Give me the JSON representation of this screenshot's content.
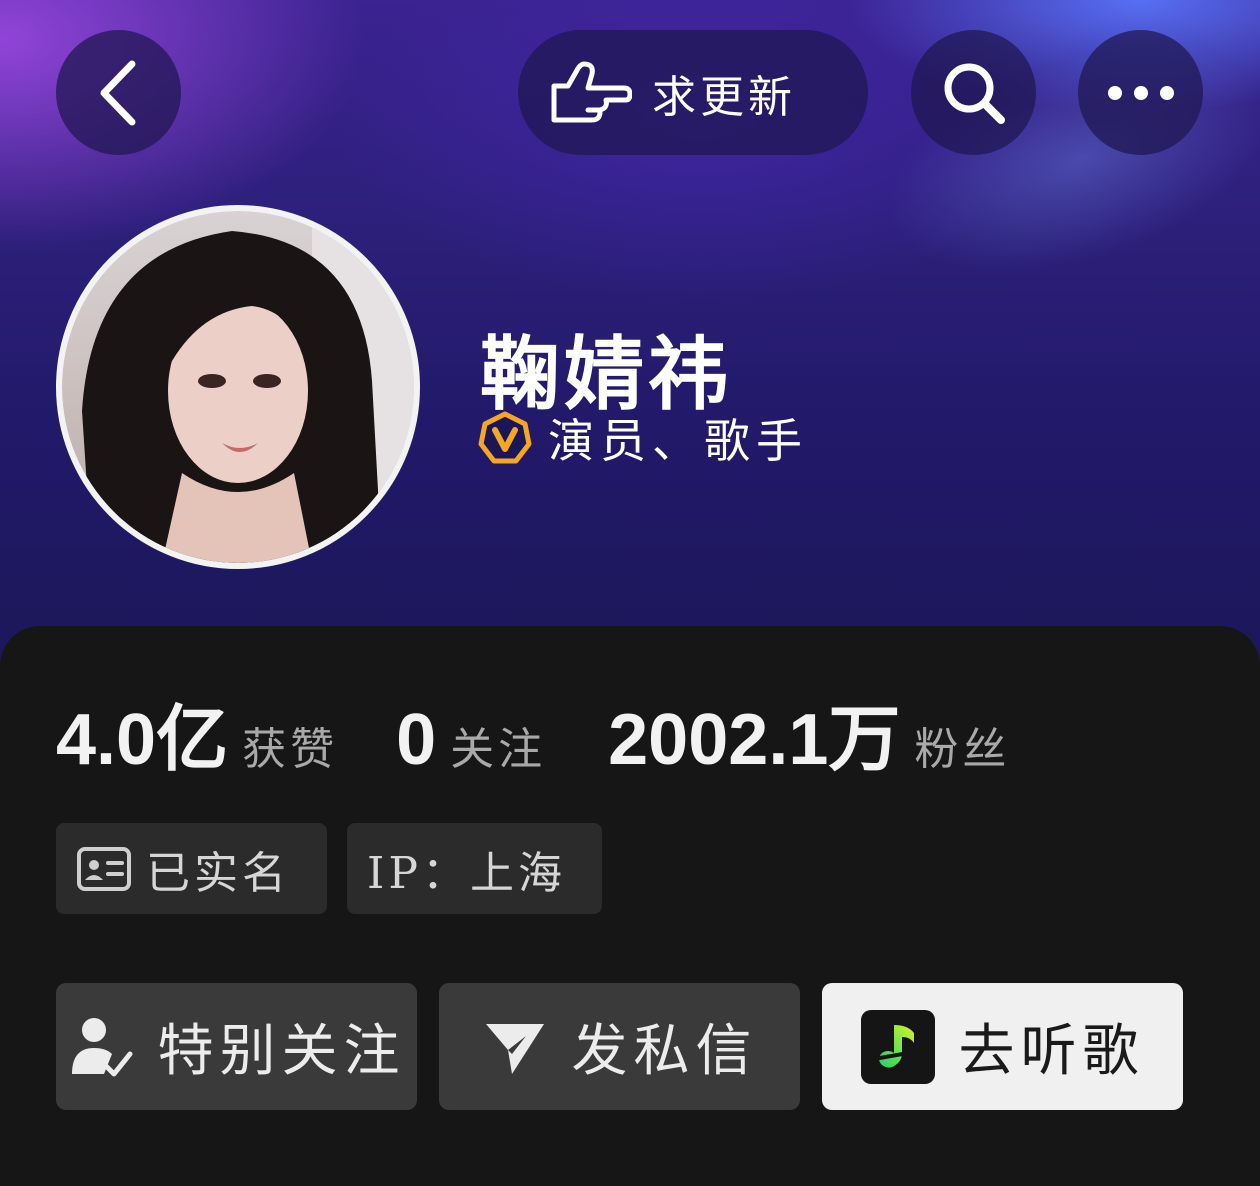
{
  "header": {
    "back_icon": "chevron-left-icon",
    "request_update": {
      "icon": "pointing-hand-icon",
      "label": "求更新"
    },
    "search_icon": "search-icon",
    "more_icon": "more-dots-icon"
  },
  "profile": {
    "name": "鞠婧祎",
    "verified_icon": "verified-v-badge-icon",
    "verified_color": "#F5A623",
    "roles": "演员、歌手"
  },
  "stats": [
    {
      "value": "4.0亿",
      "label": "获赞"
    },
    {
      "value": "0",
      "label": "关注"
    },
    {
      "value": "2002.1万",
      "label": "粉丝"
    }
  ],
  "tags": {
    "verified_name": {
      "icon": "id-card-icon",
      "label": "已实名"
    },
    "ip": {
      "label": "IP：上海"
    }
  },
  "actions": {
    "special_follow": {
      "icon": "user-check-icon",
      "label": "特别关注"
    },
    "message": {
      "icon": "send-icon",
      "label": "发私信"
    },
    "listen": {
      "icon": "music-app-icon",
      "label": "去听歌"
    }
  }
}
